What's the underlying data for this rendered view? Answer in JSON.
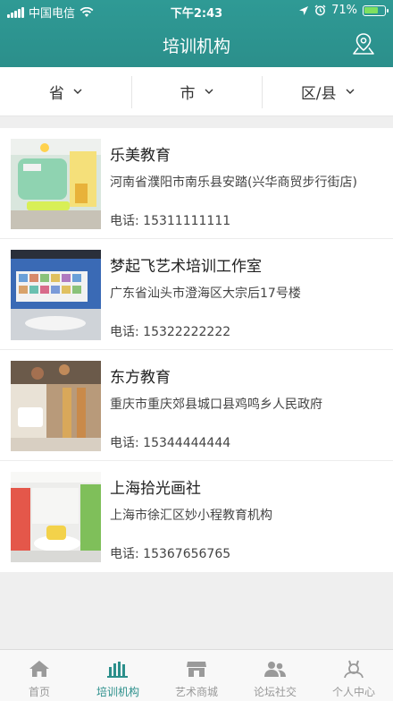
{
  "status_bar": {
    "carrier": "中国电信",
    "time": "下午2:43",
    "battery": "71%",
    "battery_level": 0.71
  },
  "nav": {
    "title": "培训机构",
    "location_icon": "location-pin-icon"
  },
  "filters": [
    {
      "label": "省"
    },
    {
      "label": "市"
    },
    {
      "label": "区/县"
    }
  ],
  "institutions": [
    {
      "name": "乐美教育",
      "address": "河南省濮阳市南乐县安踏(兴华商贸步行街店)",
      "phone": "电话: 15311111111"
    },
    {
      "name": "梦起飞艺术培训工作室",
      "address": "广东省汕头市澄海区大宗后17号楼",
      "phone": "电话: 15322222222"
    },
    {
      "name": "东方教育",
      "address": "重庆市重庆郊县城口县鸡鸣乡人民政府",
      "phone": "电话: 15344444444"
    },
    {
      "name": "上海拾光画社",
      "address": "上海市徐汇区妙小程教育机构",
      "phone": "电话: 15367656765"
    }
  ],
  "tabs": [
    {
      "label": "首页",
      "icon": "home-icon",
      "active": false
    },
    {
      "label": "培训机构",
      "icon": "institution-icon",
      "active": true
    },
    {
      "label": "艺术商城",
      "icon": "shop-icon",
      "active": false
    },
    {
      "label": "论坛社交",
      "icon": "community-icon",
      "active": false
    },
    {
      "label": "个人中心",
      "icon": "profile-icon",
      "active": false
    }
  ],
  "colors": {
    "brand": "#2b8f8b",
    "tab_inactive": "#999999",
    "background": "#efefef"
  }
}
